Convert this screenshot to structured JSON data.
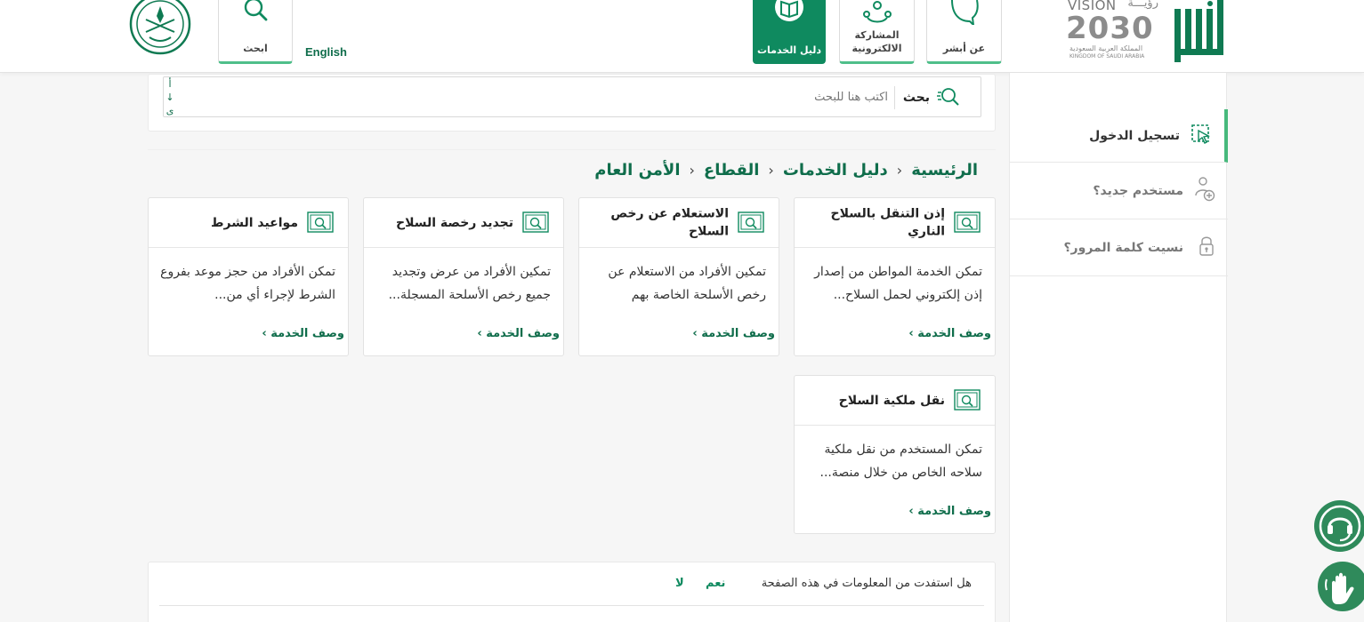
{
  "header": {
    "nav": [
      {
        "label": "عن أبشر",
        "icon": "speech-bubble-icon"
      },
      {
        "label_line1": "المشاركة",
        "label_line2": "الالكترونية",
        "icon": "people-network-icon"
      },
      {
        "label": "دليل الخدمات",
        "icon": "book-icon",
        "active": true
      }
    ],
    "search_label": "ابحث",
    "language": "English",
    "vision": {
      "latin": "VISION",
      "arabic": "رؤيـــة",
      "year": "2030",
      "kingdom_ar": "المملكة العربية السعودية",
      "kingdom_en": "KINGDOM OF SAUDI ARABIA"
    }
  },
  "search": {
    "label": "بحث",
    "placeholder": "اكتب هنا للبحث",
    "sort_top": "أ",
    "sort_arrow": "↓",
    "sort_bottom": "ى"
  },
  "breadcrumb": [
    "الرئيسية",
    "دليل الخدمات",
    "القطاع",
    "الأمن العام"
  ],
  "breadcrumb_separator": "›",
  "cards": [
    {
      "title": "إذن التنقل بالسلاح الناري",
      "desc": "تمكن الخدمة المواطن من إصدار إذن إلكتروني لحمل السلاح...",
      "link": "وصف الخدمة ›"
    },
    {
      "title": "الاستعلام عن رخص السلاح",
      "desc": "تمكين الأفراد من الاستعلام عن رخص الأسلحة الخاصة بهم",
      "link": "وصف الخدمة ›"
    },
    {
      "title": "تجديد رخصة السلاح",
      "desc": "تمكين الأفراد من عرض وتجديد جميع رخص الأسلحة المسجلة...",
      "link": "وصف الخدمة ›"
    },
    {
      "title": "مواعيد الشرط",
      "desc": "تمكن الأفراد من حجز موعد بفروع الشرط لإجراء أي من...",
      "link": "وصف الخدمة ›"
    },
    {
      "title": "نقل ملكية السلاح",
      "desc": "تمكن المستخدم من نقل ملكية سلاحه الخاص من خلال منصة...",
      "link": "وصف الخدمة ›"
    }
  ],
  "feedback": {
    "question": "هل استفدت من المعلومات في هذه الصفحة",
    "yes": "نعم",
    "no": "لا"
  },
  "sidebar": {
    "items": [
      {
        "label": "تسجيل الدخول",
        "icon": "login-cursor-icon",
        "active": true
      },
      {
        "label": "مستخدم جديد؟",
        "icon": "add-user-icon"
      },
      {
        "label": "نسيت كلمة المرور؟",
        "icon": "lock-icon"
      }
    ]
  },
  "colors": {
    "brand_green": "#0f8a5f",
    "dark_green": "#0f6d4b",
    "accent_green": "#47b97c"
  }
}
